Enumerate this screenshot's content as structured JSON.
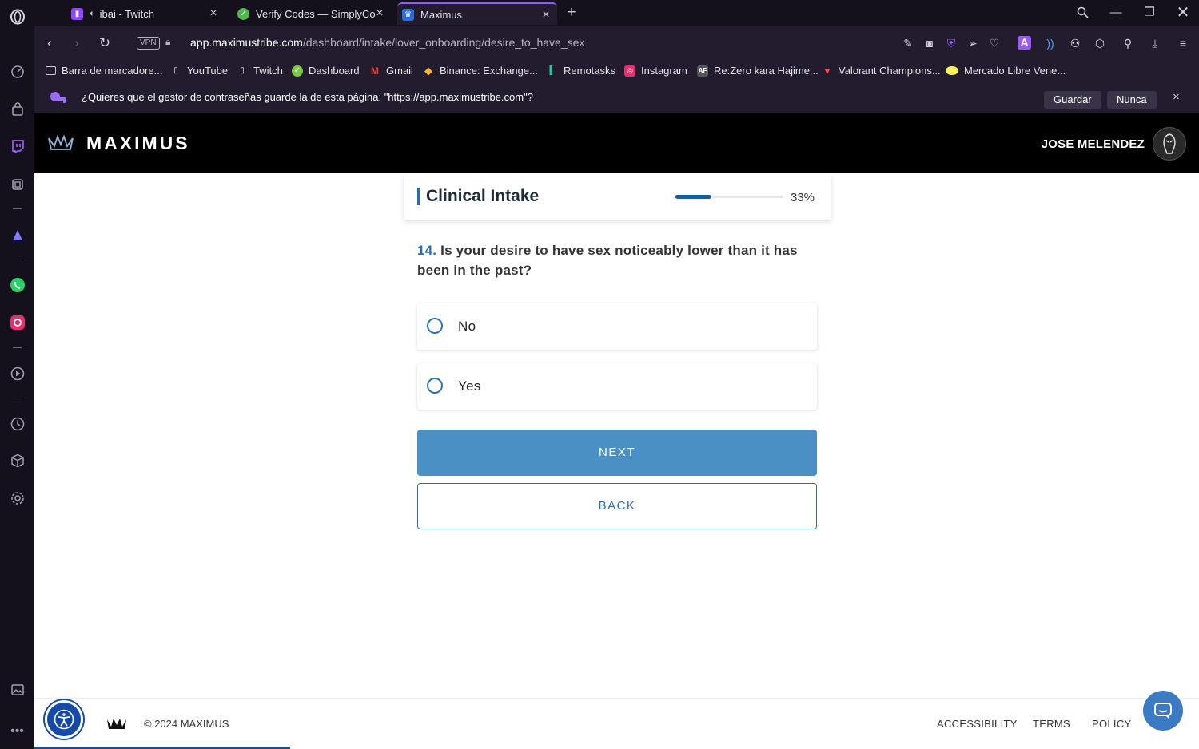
{
  "browser": {
    "tabs": [
      {
        "label": "ibai - Twitch"
      },
      {
        "label": "Verify Codes — SimplyCodes"
      },
      {
        "label": "Maximus"
      }
    ],
    "url_domain": "app.maximustribe.com",
    "url_path": "/dashboard/intake/lover_onboarding/desire_to_have_sex",
    "vpn_label": "VPN",
    "bookmarks": [
      {
        "label": "Barra de marcadore..."
      },
      {
        "label": "YouTube"
      },
      {
        "label": "Twitch"
      },
      {
        "label": "Dashboard"
      },
      {
        "label": "Gmail"
      },
      {
        "label": "Binance: Exchange..."
      },
      {
        "label": "Remotasks"
      },
      {
        "label": "Instagram"
      },
      {
        "label": "Re:Zero kara Hajime..."
      },
      {
        "label": "Valorant Champions..."
      },
      {
        "label": "Mercado Libre Vene..."
      }
    ],
    "password_prompt": {
      "text": "¿Quieres que el gestor de contraseñas guarde la de esta página: \"https://app.maximustribe.com\"?",
      "save_label": "Guardar",
      "never_label": "Nunca"
    }
  },
  "site": {
    "brand": "MAXIMUS",
    "user_name": "JOSE MELENDEZ"
  },
  "intake": {
    "title": "Clinical Intake",
    "progress_percent": 33,
    "progress_label": "33%",
    "question_number": "14.",
    "question_text": "Is your desire to have sex noticeably lower than it has been in the past?",
    "options": [
      {
        "label": "No"
      },
      {
        "label": "Yes"
      }
    ],
    "next_label": "NEXT",
    "back_label": "BACK"
  },
  "footer": {
    "copyright": "© 2024 MAXIMUS",
    "links": [
      {
        "label": "ACCESSIBILITY"
      },
      {
        "label": "TERMS"
      },
      {
        "label": "POLICY"
      }
    ]
  },
  "colors": {
    "accent": "#4a90c4",
    "brand_blue": "#2a6db0",
    "browser_purple": "#8e5cff"
  }
}
